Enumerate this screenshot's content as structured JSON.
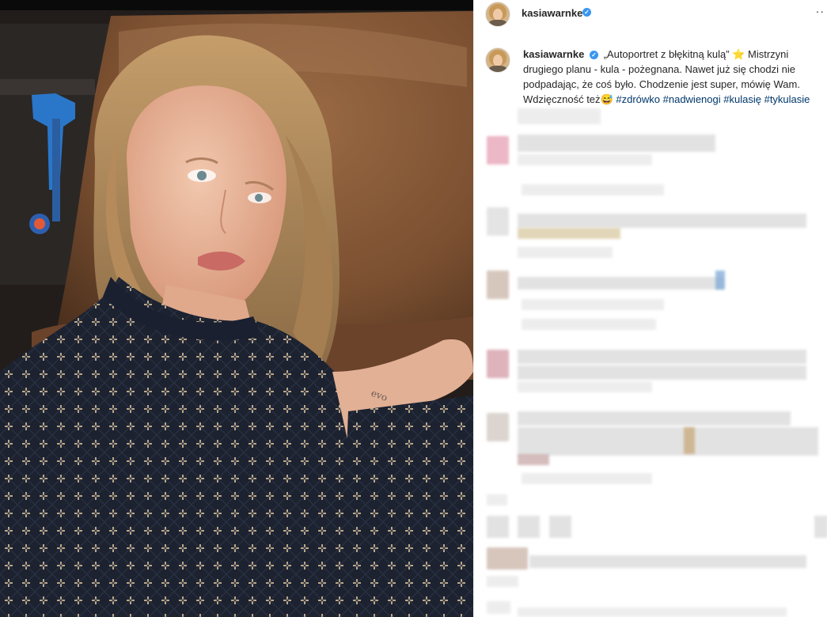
{
  "post": {
    "username": "kasiawarnke",
    "more_icon": "more-horizontal-icon",
    "verified_icon": "verified-badge-icon"
  },
  "caption": {
    "username": "kasiawarnke",
    "text_quote": "„Autoportret z błękitną kulą”",
    "star": "⭐",
    "text_body": " Mistrzyni drugiego planu - kula - pożegnana. Nawet już się chodzi nie podpadając, że coś było. Chodzenie jest super, mówię Wam. Wdzięczność też",
    "emoji": "😅",
    "hashtags": [
      "#zdrówko",
      "#nadwienogi",
      "#kulasię",
      "#tykulasie"
    ]
  },
  "colors": {
    "link": "#00376b",
    "verified": "#3897f0",
    "text": "#262626"
  }
}
